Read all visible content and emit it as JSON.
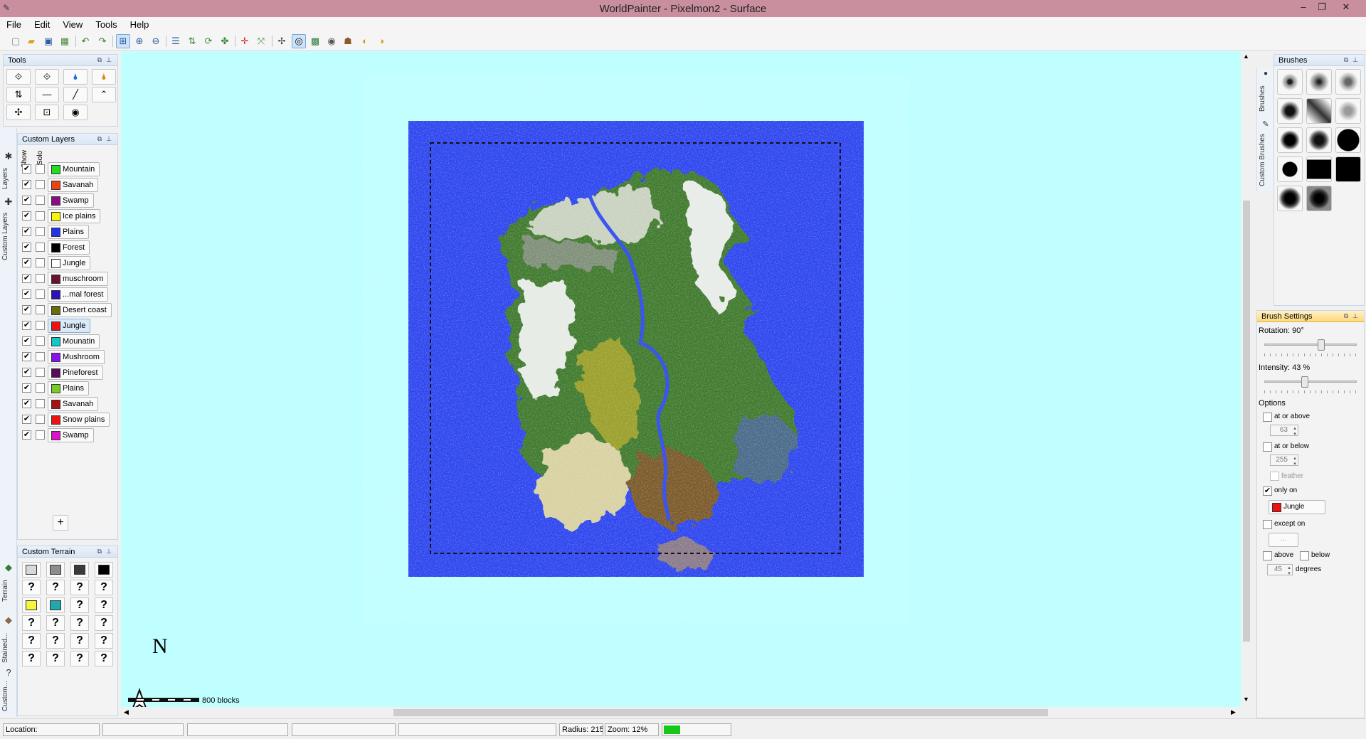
{
  "window": {
    "title": "WorldPainter - Pixelmon2 - Surface"
  },
  "menu": [
    "File",
    "Edit",
    "View",
    "Tools",
    "Help"
  ],
  "panels": {
    "tools": "Tools",
    "custom_layers": "Custom Layers",
    "custom_terrain": "Custom Terrain",
    "brushes": "Brushes",
    "brush_settings": "Brush Settings"
  },
  "left_tabs": {
    "layers": "Layers",
    "custom_layers": "Custom Layers",
    "terrain": "Terrain",
    "stained": "Stained...",
    "custom": "Custom..."
  },
  "right_tabs": {
    "brushes": "Brushes",
    "custom_brushes": "Custom Brushes"
  },
  "layer_columns": {
    "show": "Show",
    "solo": "Solo"
  },
  "layers": [
    {
      "name": "Mountain",
      "color": "#22dd22"
    },
    {
      "name": "Savanah",
      "color": "#ee4411"
    },
    {
      "name": "Swamp",
      "color": "#8a0a8a"
    },
    {
      "name": "Ice plains",
      "color": "#f5f50a"
    },
    {
      "name": "Plains",
      "color": "#2233ee"
    },
    {
      "name": "Forest",
      "color": "#000000"
    },
    {
      "name": "Jungle",
      "color": "#ffffff"
    },
    {
      "name": "muschroom",
      "color": "#6b1030"
    },
    {
      "name": "...mal forest",
      "color": "#2a12b8"
    },
    {
      "name": "Desert coast",
      "color": "#6b6b10"
    },
    {
      "name": "Jungle",
      "color": "#ee1111"
    },
    {
      "name": "Mounatin",
      "color": "#11c8c8"
    },
    {
      "name": "Mushroom",
      "color": "#8a11ee"
    },
    {
      "name": "Pineforest",
      "color": "#5a0a5a"
    },
    {
      "name": "Plains",
      "color": "#77cc22"
    },
    {
      "name": "Savanah",
      "color": "#aa1111"
    },
    {
      "name": "Snow plains",
      "color": "#ee1111"
    },
    {
      "name": "Swamp",
      "color": "#dd11cc"
    }
  ],
  "selected_layer_index": 10,
  "terrain_colors": [
    "#d8d8d8",
    "#8c8c8c",
    "#3a3a3a",
    "#000000",
    "#f5f53a",
    "#22a8a8"
  ],
  "terrain_unknown": "?",
  "brush_settings": {
    "rotation_label": "Rotation: 90°",
    "rotation_value": 90,
    "intensity_label": "Intensity: 43 %",
    "intensity_value": 43,
    "options_label": "Options",
    "at_or_above": {
      "label": "at or above",
      "value": "63"
    },
    "at_or_below": {
      "label": "at or below",
      "value": "255"
    },
    "feather": "feather",
    "only_on": {
      "label": "only on",
      "layer": "Jungle",
      "color": "#ee1111"
    },
    "except_on": {
      "label": "except on",
      "value": "..."
    },
    "above": "above",
    "below": "below",
    "degrees": {
      "value": "45",
      "label": "degrees"
    }
  },
  "map": {
    "ocean_color": "#2e46ee",
    "scale_label": "800 blocks",
    "compass": "N"
  },
  "status": {
    "location": "Location:",
    "radius": "Radius: 215",
    "zoom": "Zoom: 12%",
    "progress": 0.25
  }
}
